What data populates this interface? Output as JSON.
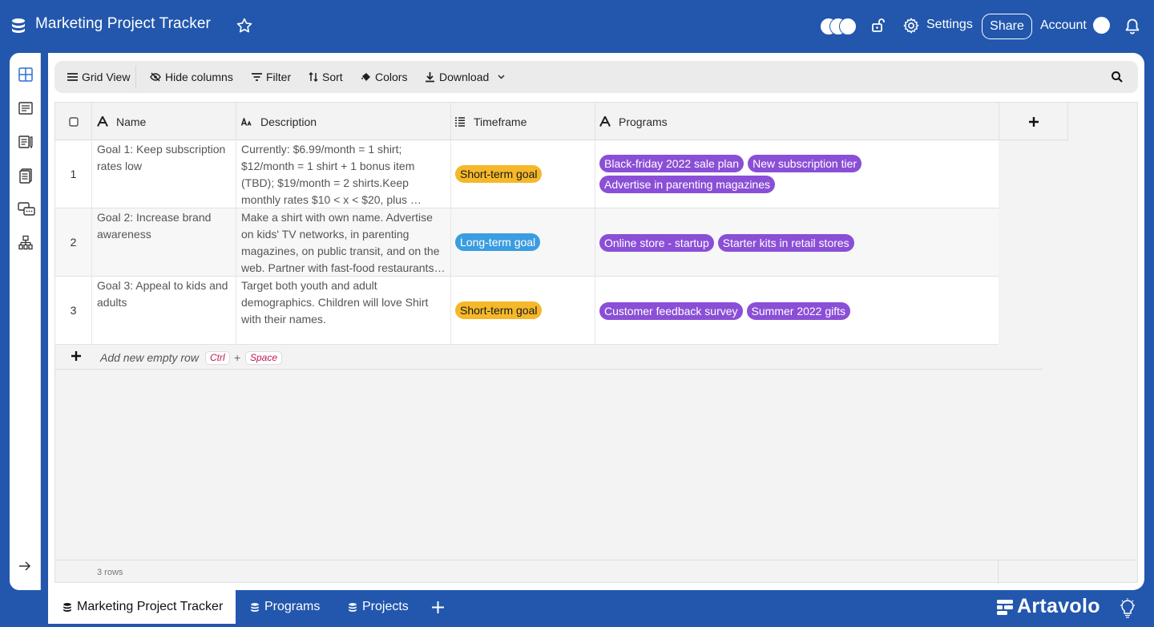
{
  "app": {
    "title": "Marketing Project Tracker",
    "settings_label": "Settings",
    "share_label": "Share",
    "account_label": "Account"
  },
  "toolbar": {
    "grid_view": "Grid View",
    "hide_columns": "Hide columns",
    "filter": "Filter",
    "sort": "Sort",
    "colors": "Colors",
    "download": "Download"
  },
  "grid": {
    "columns": [
      {
        "label": "Name",
        "icon": "text-type-icon"
      },
      {
        "label": "Description",
        "icon": "long-text-icon"
      },
      {
        "label": "Timeframe",
        "icon": "list-icon"
      },
      {
        "label": "Programs",
        "icon": "text-type-icon"
      }
    ],
    "rows": [
      {
        "num": "1",
        "name": "Goal 1: Keep subscription rates low",
        "description": "Currently: $6.99/month = 1 shirt; $12/month = 1 shirt + 1 bonus item (TBD); $19/month = 2 shirts.Keep monthly rates $10 < x < $20, plus …",
        "timeframe": "Short-term goal",
        "programs": [
          "Black-friday 2022 sale plan",
          "New subscription tier",
          "Advertise in parenting magazines"
        ]
      },
      {
        "num": "2",
        "name": "Goal 2: Increase brand awareness",
        "description": "Make a shirt with own name. Advertise on kids' TV networks, in parenting magazines, on public transit, and on the web. Partner with fast-food restaurants…",
        "timeframe": "Long-term goal",
        "programs": [
          "Online store - startup",
          "Starter kits in retail stores"
        ]
      },
      {
        "num": "3",
        "name": "Goal 3: Appeal to kids and adults",
        "description": "Target both youth and adult demographics. Children will love Shirt with their names.",
        "timeframe": "Short-term goal",
        "programs": [
          "Customer feedback survey",
          "Summer 2022 gifts"
        ]
      }
    ],
    "add_row_label": "Add new empty row",
    "kbd_ctrl": "Ctrl",
    "kbd_plus": "+",
    "kbd_space": "Space",
    "row_count": "3 rows"
  },
  "tabs": [
    {
      "label": "Marketing Project Tracker",
      "active": true
    },
    {
      "label": "Programs",
      "active": false
    },
    {
      "label": "Projects",
      "active": false
    }
  ],
  "brand": "Artavolo",
  "colors": {
    "background": "#2257ad",
    "short_term": "#f5b82a",
    "long_term": "#3a9de0",
    "program": "#8a4fd6"
  }
}
